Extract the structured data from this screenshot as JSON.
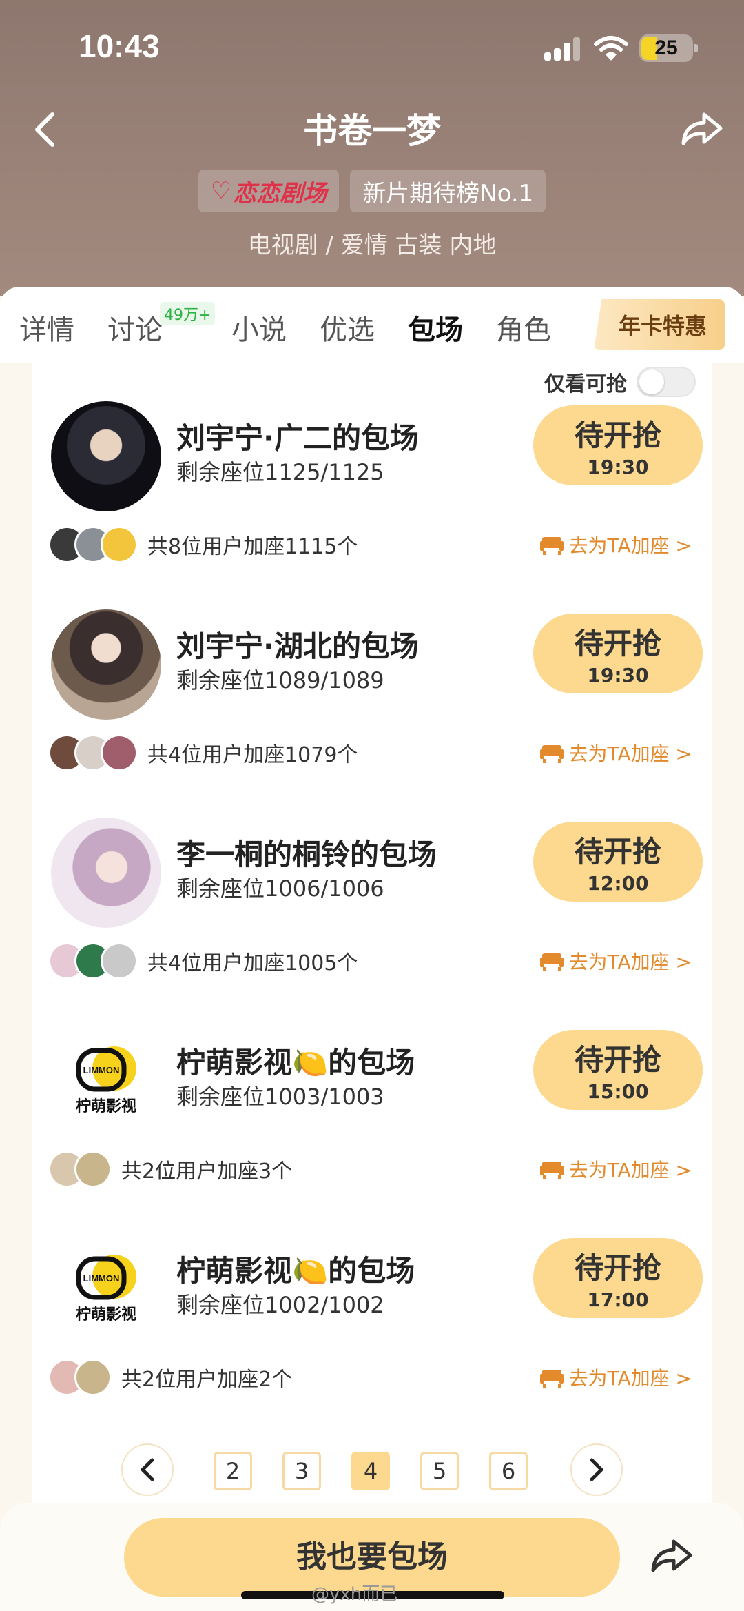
{
  "status_bar": {
    "time": "10:43",
    "battery": "25"
  },
  "header": {
    "title": "书卷一梦",
    "brand_badge": "恋恋剧场",
    "rank_badge": "新片期待榜No.1",
    "genres": "电视剧 / 爱情 古装 内地"
  },
  "tabs": [
    {
      "label": "详情"
    },
    {
      "label": "讨论",
      "badge": "49万+"
    },
    {
      "label": "小说"
    },
    {
      "label": "优选"
    },
    {
      "label": "包场"
    },
    {
      "label": "角色"
    }
  ],
  "annual_card": "年卡特惠",
  "filter": {
    "label": "仅看可抢",
    "enabled": false
  },
  "items": [
    {
      "title": "刘宇宁·广二的包场",
      "seats": "剩余座位1125/1125",
      "button": "待开抢",
      "time": "19:30",
      "users": "共8位用户加座1115个",
      "join": "去为TA加座 >"
    },
    {
      "title": "刘宇宁·湖北的包场",
      "seats": "剩余座位1089/1089",
      "button": "待开抢",
      "time": "19:30",
      "users": "共4位用户加座1079个",
      "join": "去为TA加座 >"
    },
    {
      "title": "李一桐的桐铃的包场",
      "seats": "剩余座位1006/1006",
      "button": "待开抢",
      "time": "12:00",
      "users": "共4位用户加座1005个",
      "join": "去为TA加座 >"
    },
    {
      "title": "柠萌影视🍋的包场",
      "seats": "剩余座位1003/1003",
      "button": "待开抢",
      "time": "15:00",
      "users": "共2位用户加座3个",
      "join": "去为TA加座 >"
    },
    {
      "title": "柠萌影视🍋的包场",
      "seats": "剩余座位1002/1002",
      "button": "待开抢",
      "time": "17:00",
      "users": "共2位用户加座2个",
      "join": "去为TA加座 >"
    }
  ],
  "logo": {
    "brand_en": "LIMMON",
    "brand_cn": "柠萌影视"
  },
  "pager": {
    "pages": [
      "2",
      "3",
      "4",
      "5",
      "6"
    ],
    "current": "4"
  },
  "cta": "我也要包场",
  "watermark": "@yxh而已",
  "colors": {
    "accent": "#fcd98f",
    "link": "#e28a2c",
    "header": "#9a8278"
  }
}
